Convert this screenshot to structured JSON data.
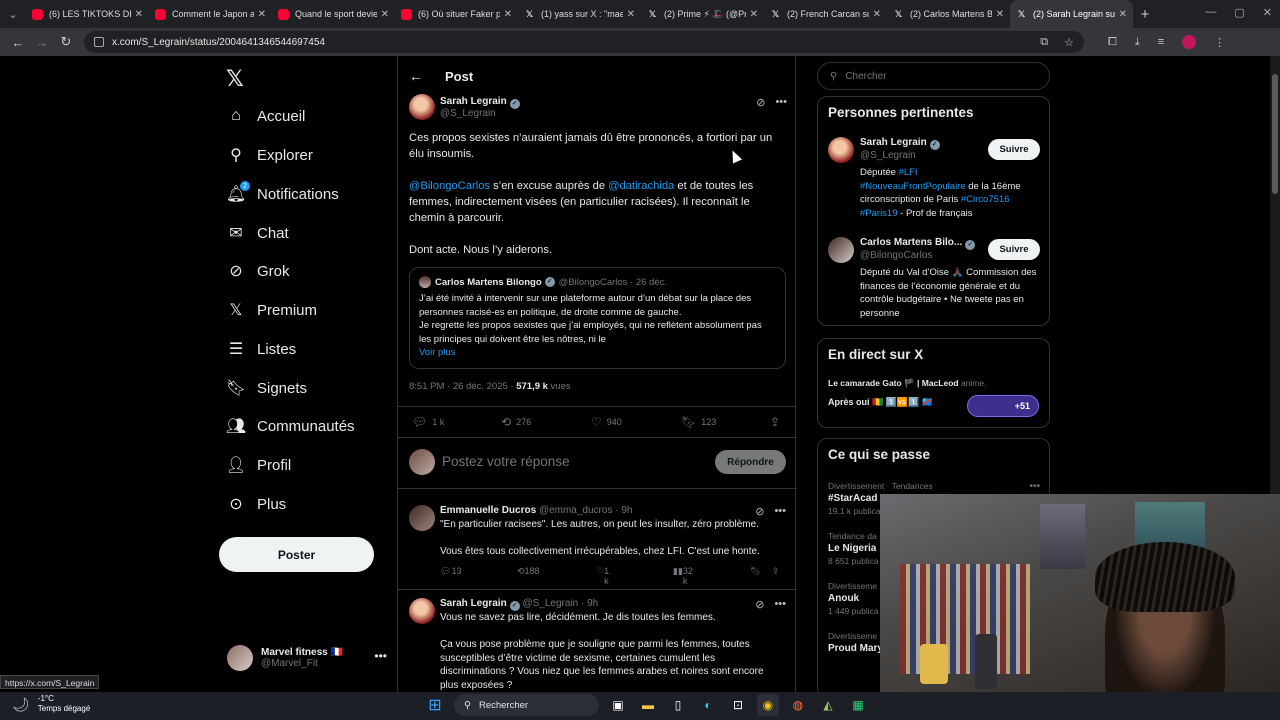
{
  "browser": {
    "tabs": [
      {
        "title": "(6) LES TIKTOKS DES",
        "type": "yt"
      },
      {
        "title": "Comment le Japon a",
        "type": "yt"
      },
      {
        "title": "Quand le sport devie",
        "type": "yt"
      },
      {
        "title": "(6) Où situer Faker pa",
        "type": "yt"
      },
      {
        "title": "(1) yass sur X : \"maev",
        "type": "x"
      },
      {
        "title": "(2) Prime ⚡ 🎩 (@Pr",
        "type": "x"
      },
      {
        "title": "(2) French Carcan sur",
        "type": "x"
      },
      {
        "title": "(2) Carlos Martens Bi",
        "type": "x"
      },
      {
        "title": "(2) Sarah Legrain sur",
        "type": "x",
        "active": true
      }
    ],
    "url": "x.com/S_Legrain/status/2004641346544697454",
    "status_url": "https://x.com/S_Legrain"
  },
  "nav": {
    "items": [
      {
        "label": "Accueil",
        "icon": "home-icon"
      },
      {
        "label": "Explorer",
        "icon": "search-icon"
      },
      {
        "label": "Notifications",
        "icon": "bell-icon",
        "badge": "2"
      },
      {
        "label": "Chat",
        "icon": "mail-icon"
      },
      {
        "label": "Grok",
        "icon": "grok-icon"
      },
      {
        "label": "Premium",
        "icon": "x-icon"
      },
      {
        "label": "Listes",
        "icon": "list-icon"
      },
      {
        "label": "Signets",
        "icon": "bookmark-icon"
      },
      {
        "label": "Communautés",
        "icon": "people-icon"
      },
      {
        "label": "Profil",
        "icon": "person-icon"
      },
      {
        "label": "Plus",
        "icon": "more-circle-icon"
      }
    ],
    "post_button": "Poster",
    "account": {
      "name": "Marvel fitness 🇫🇷",
      "handle": "@Marvel_Fit"
    }
  },
  "post": {
    "header_title": "Post",
    "author_name": "Sarah Legrain",
    "author_handle": "@S_Legrain",
    "paragraph1": "Ces propos sexistes n’auraient jamais dû être prononcés, a fortiori par un élu insoumis.",
    "mention1": "@BilongoCarlos",
    "p2_mid": " s’en excuse auprès de ",
    "mention2": "@datirachida",
    "p2_end": " et de toutes les femmes, indirectement visées (en particulier racisées). Il reconnaît le chemin à parcourir.",
    "paragraph3": "Dont acte. Nous l’y aiderons.",
    "quote": {
      "name": "Carlos Martens Bilongo",
      "meta": "@BilongoCarlos · 26 déc.",
      "line1": "J’ai été invité à intervenir sur une plateforme autour d’un débat sur la place des personnes racisé-es en politique, de droite comme de gauche.",
      "line2": "Je regrette les propos sexistes que j’ai employés, qui ne reflètent absolument pas les principes qui doivent être les nôtres, ni le",
      "more": "Voir plus"
    },
    "time": "8:51 PM · 26 déc. 2025 · ",
    "views": "571,9 k",
    "views_label": " vues",
    "stats": {
      "replies": "1 k",
      "reposts": "276",
      "likes": "940",
      "bookmarks": "123"
    },
    "reply_placeholder": "Postez votre réponse",
    "reply_button": "Répondre"
  },
  "replies": [
    {
      "name": "Emmanuelle Ducros",
      "meta": "@emma_ducros · 9h",
      "p1": "\"En particulier racisees\". Les autres, on peut les insulter, zéro problème.",
      "p2": "Vous êtes tous collectivement irrécupérables, chez LFI. C'est une honte.",
      "replies": "13",
      "reposts": "188",
      "likes": "1 k",
      "views": "32 k"
    },
    {
      "name": "Sarah Legrain",
      "meta": "@S_Legrain · 9h",
      "p1": "Vous ne savez pas lire, décidément. Je dis toutes les femmes.",
      "p2": "Ça vous pose problème que je souligne que parmi les femmes, toutes susceptibles d’être victime de sexisme, certaines cumulent les discriminations ? Vous niez que les femmes arabes et noires sont encore plus exposées ?"
    }
  ],
  "sidebar": {
    "search_placeholder": "Chercher",
    "relevant_title": "Personnes pertinentes",
    "people": [
      {
        "name": "Sarah Legrain",
        "handle": "@S_Legrain",
        "follow": "Suivre",
        "bio_a": "Députée ",
        "bio_tag1": "#LFI",
        "bio_tag2": "#NouveauFrontPopulaire",
        "bio_b": " de la 16ème circonscription de Paris ",
        "bio_tag3": "#Circo7516",
        "bio_tag4": "#Paris19",
        "bio_c": " - Prof de français"
      },
      {
        "name": "Carlos Martens Bilo...",
        "handle": "@BilongoCarlos",
        "follow": "Suivre",
        "bio": "Député du Val d’Oise 🙏🏿 Commission des finances de l’économie générale et du contrôle budgétaire • Ne tweete pas en personne"
      }
    ],
    "live_title": "En direct sur X",
    "live_host": "Le camarade Gato 🏴 | MacLeod",
    "live_suffix": " anime.",
    "live_topic": "Après oui 🇬🇳 1️⃣🆚1️⃣ 🇨🇩",
    "live_count": "+51",
    "trends_title": "Ce qui se passe",
    "trends": [
      {
        "category": "Divertissement · Tendances",
        "name": "#StarAcad",
        "count": "19,1 k publicat"
      },
      {
        "category": "Tendance da",
        "name": "Le Nigeria",
        "count": "8 651 publica"
      },
      {
        "category": "Divertisseme",
        "name": "Anouk",
        "count": "1 449 publica"
      },
      {
        "category": "Divertisseme",
        "name": "Proud Mary",
        "count": ""
      }
    ]
  },
  "taskbar": {
    "temp": "-1°C",
    "weather": "Temps dégagé",
    "search": "Rechercher"
  }
}
